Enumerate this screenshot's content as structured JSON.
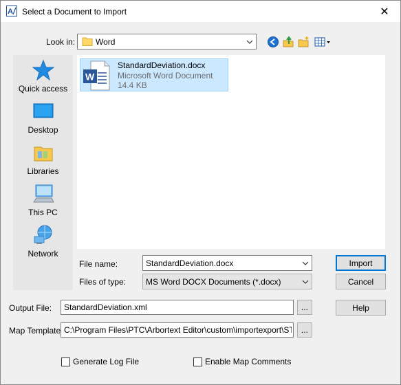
{
  "window": {
    "title": "Select a Document to Import",
    "close_glyph": "✕"
  },
  "lookin": {
    "label": "Look in:",
    "value": "Word"
  },
  "toolbar": {
    "icons": [
      "back-icon",
      "up-folder-icon",
      "new-folder-icon",
      "view-menu-icon"
    ]
  },
  "places": [
    {
      "label": "Quick access",
      "icon": "star-icon"
    },
    {
      "label": "Desktop",
      "icon": "desktop-icon"
    },
    {
      "label": "Libraries",
      "icon": "libraries-icon"
    },
    {
      "label": "This PC",
      "icon": "computer-icon"
    },
    {
      "label": "Network",
      "icon": "network-icon"
    }
  ],
  "files": [
    {
      "name": "StandardDeviation.docx",
      "type": "Microsoft Word Document",
      "size": "14.4 KB",
      "icon": "word-doc-icon"
    }
  ],
  "filename": {
    "label": "File name:",
    "value": "StandardDeviation.docx"
  },
  "filetype": {
    "label": "Files of type:",
    "value": "MS Word DOCX Documents (*.docx)"
  },
  "buttons": {
    "import": "Import",
    "cancel": "Cancel",
    "help": "Help",
    "browse": "..."
  },
  "output": {
    "label": "Output File:",
    "value": "StandardDeviation.xml"
  },
  "map": {
    "label": "Map Template:",
    "value": "C:\\Program Files\\PTC\\Arbortext Editor\\custom\\importexport\\STDTem"
  },
  "options": {
    "log_label": "Generate Log File",
    "log_checked": false,
    "comments_label": "Enable Map Comments",
    "comments_checked": false
  }
}
